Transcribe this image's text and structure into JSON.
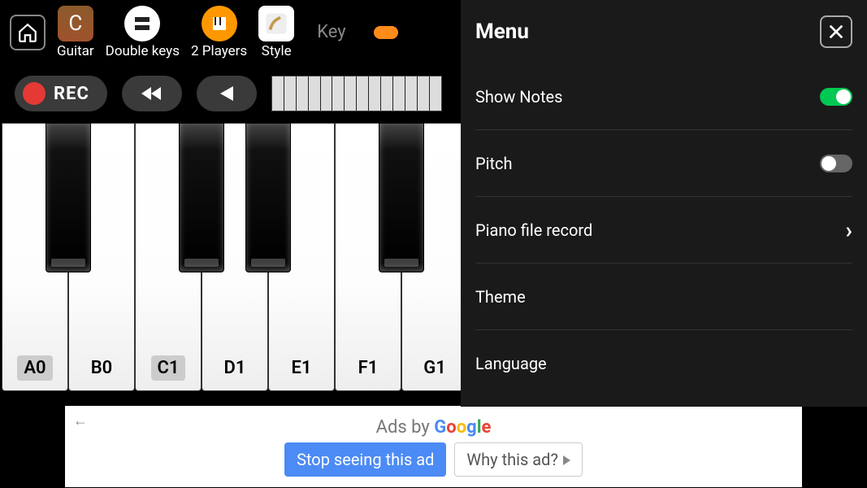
{
  "topbar": {
    "items": [
      {
        "label": "Guitar"
      },
      {
        "label": "Double keys"
      },
      {
        "label": "2 Players"
      },
      {
        "label": "Style"
      }
    ],
    "key_truncated": "Key"
  },
  "controls": {
    "rec": "REC"
  },
  "keyboard": {
    "white_keys": [
      "A0",
      "B0",
      "C1",
      "D1",
      "E1",
      "F1",
      "G1"
    ],
    "active_keys": [
      "A0",
      "C1"
    ],
    "black_keys_after_index": [
      0,
      2,
      3,
      5
    ]
  },
  "menu": {
    "title": "Menu",
    "items": [
      {
        "label": "Show Notes",
        "type": "toggle",
        "on": true
      },
      {
        "label": "Pitch",
        "type": "toggle",
        "on": false
      },
      {
        "label": "Piano file record",
        "type": "nav"
      },
      {
        "label": "Theme",
        "type": "plain"
      },
      {
        "label": "Language",
        "type": "plain"
      }
    ]
  },
  "ad": {
    "ads_by": "Ads by ",
    "google": "Google",
    "stop": "Stop seeing this ad",
    "why": "Why this ad?"
  }
}
